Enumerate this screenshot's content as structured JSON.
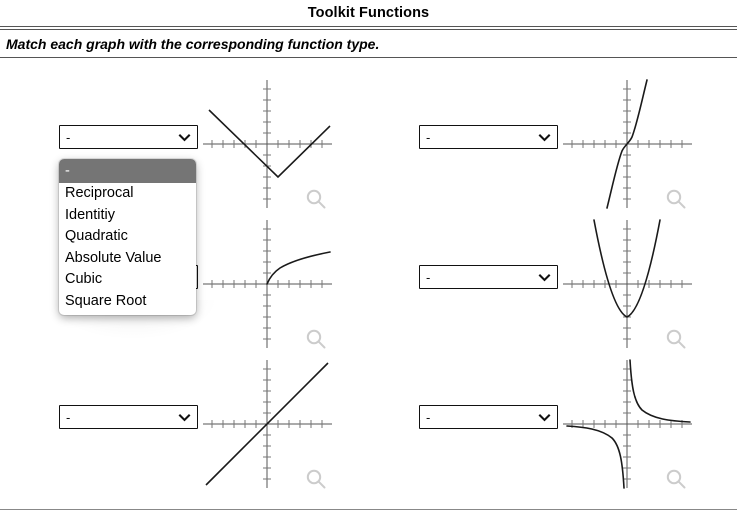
{
  "header": {
    "title": "Toolkit Functions",
    "instruction": "Match each graph with the corresponding function type."
  },
  "select_placeholder": "-",
  "dropdown": {
    "open_for_problem": 1,
    "options": [
      "-",
      "Reciprocal",
      "Identitiy",
      "Quadratic",
      "Absolute Value",
      "Cubic",
      "Square Root"
    ],
    "selected_option": "-"
  },
  "icons": {
    "chevron": "chevron-down-icon",
    "magnifier": "magnifier-icon"
  },
  "colors": {
    "curve": "#1a1a1a",
    "axis": "#555555",
    "tick": "#777777",
    "highlight": "#757575",
    "border": "#111111",
    "magnifier": "#cccccc"
  },
  "problems": [
    {
      "id": 1,
      "selected": "-",
      "graph": {
        "function_type": "Absolute Value",
        "expression": "y = |x - 1| - 3",
        "shape": "v-shape",
        "vertex": [
          1,
          -3
        ]
      }
    },
    {
      "id": 2,
      "selected": "-",
      "graph": {
        "function_type": "Cubic",
        "expression": "y = x^3",
        "shape": "s-curve",
        "inflection": [
          0,
          0
        ]
      }
    },
    {
      "id": 3,
      "selected": "-",
      "graph": {
        "function_type": "Square Root",
        "expression": "y = sqrt(x)",
        "shape": "half-parabola",
        "origin": [
          0,
          0
        ]
      }
    },
    {
      "id": 4,
      "selected": "-",
      "graph": {
        "function_type": "Quadratic",
        "expression": "y = x^2 - 3",
        "shape": "parabola",
        "vertex": [
          0,
          -3
        ]
      }
    },
    {
      "id": 5,
      "selected": "-",
      "graph": {
        "function_type": "Identitiy",
        "expression": "y = x",
        "shape": "line",
        "slope": 1
      }
    },
    {
      "id": 6,
      "selected": "-",
      "graph": {
        "function_type": "Reciprocal",
        "expression": "y = 1/x",
        "shape": "hyperbola",
        "asymptotes": [
          "x = 0",
          "y = 0"
        ]
      }
    }
  ],
  "chart_data": {
    "type": "line",
    "title": "Toolkit Functions",
    "xlabel": "",
    "ylabel": "",
    "grid": false,
    "legend": "none",
    "xlim": [
      -6,
      6
    ],
    "ylim": [
      -6,
      6
    ],
    "series": [
      {
        "name": "Absolute Value",
        "panel": 1,
        "expression": "y = |x - 1| - 3",
        "x": [
          -5,
          -4,
          -3,
          -2,
          -1,
          0,
          1,
          2,
          3,
          4,
          5
        ],
        "values": [
          3,
          2,
          1,
          0,
          -1,
          -2,
          -3,
          -2,
          -1,
          0,
          1
        ]
      },
      {
        "name": "Cubic",
        "panel": 2,
        "expression": "y = x^3",
        "x": [
          -1.8,
          -1.4,
          -1.0,
          -0.5,
          0,
          0.5,
          1.0,
          1.4,
          1.8
        ],
        "values": [
          -5.83,
          -2.74,
          -1,
          -0.125,
          0,
          0.125,
          1,
          2.74,
          5.83
        ]
      },
      {
        "name": "Square Root",
        "panel": 3,
        "expression": "y = sqrt(x)",
        "x": [
          0,
          0.5,
          1,
          2,
          3,
          4,
          5,
          6
        ],
        "values": [
          0,
          0.71,
          1,
          1.41,
          1.73,
          2,
          2.24,
          2.45
        ]
      },
      {
        "name": "Quadratic",
        "panel": 4,
        "expression": "y = x^2 - 3",
        "x": [
          -3,
          -2,
          -1,
          0,
          1,
          2,
          3
        ],
        "values": [
          6,
          1,
          -2,
          -3,
          -2,
          1,
          6
        ]
      },
      {
        "name": "Identitiy",
        "panel": 5,
        "expression": "y = x",
        "x": [
          -5,
          -4,
          -3,
          -2,
          -1,
          0,
          1,
          2,
          3,
          4,
          5
        ],
        "values": [
          -5,
          -4,
          -3,
          -2,
          -1,
          0,
          1,
          2,
          3,
          4,
          5
        ]
      },
      {
        "name": "Reciprocal",
        "panel": 6,
        "expression": "y = 1/x",
        "x": [
          -5,
          -4,
          -3,
          -2,
          -1,
          -0.5,
          -0.25,
          0.25,
          0.5,
          1,
          2,
          3,
          4,
          5
        ],
        "values": [
          -0.2,
          -0.25,
          -0.33,
          -0.5,
          -1,
          -2,
          -4,
          4,
          2,
          1,
          0.5,
          0.33,
          0.25,
          0.2
        ]
      }
    ]
  }
}
